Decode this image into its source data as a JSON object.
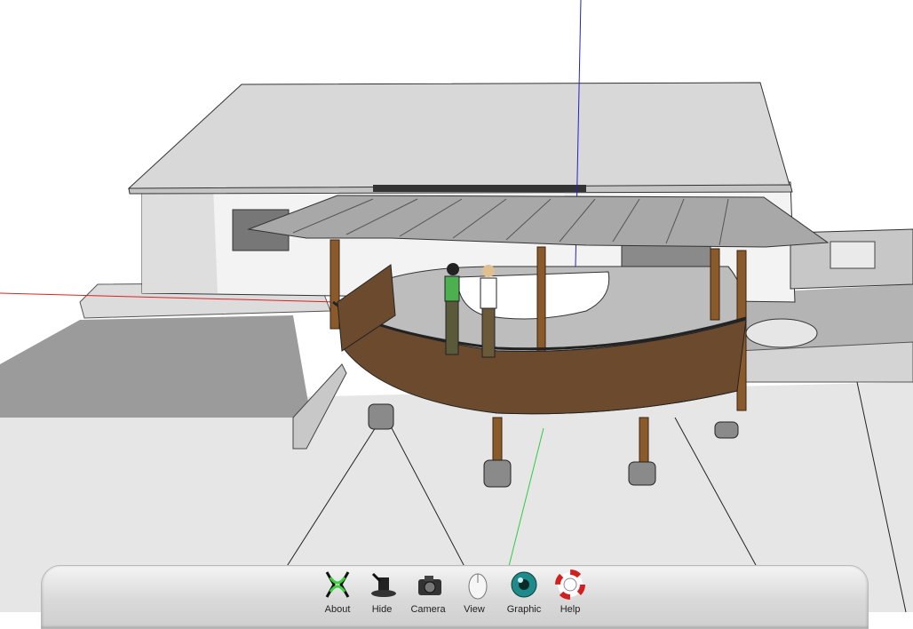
{
  "app": {
    "title": "3D modeling viewport",
    "scene_description": "Curved deck with metal roof pavilion in front of a house"
  },
  "axes": {
    "red": "#e02020",
    "green": "#2ecc40",
    "blue": "#2020c8"
  },
  "colors": {
    "wood": "#8b5a2b",
    "roof": "#9a9a9a",
    "wall": "#f0f0f0",
    "ground": "#d6d6d6"
  },
  "dock": {
    "items": [
      {
        "icon": "sandbox-icon",
        "label": "About"
      },
      {
        "icon": "magic-hat-icon",
        "label": "Hide"
      },
      {
        "icon": "camera-icon",
        "label": "Camera"
      },
      {
        "icon": "mouse-icon",
        "label": "View"
      },
      {
        "icon": "eye-icon",
        "label": "Graphic"
      },
      {
        "icon": "lifebuoy-icon",
        "label": "Help"
      }
    ]
  }
}
